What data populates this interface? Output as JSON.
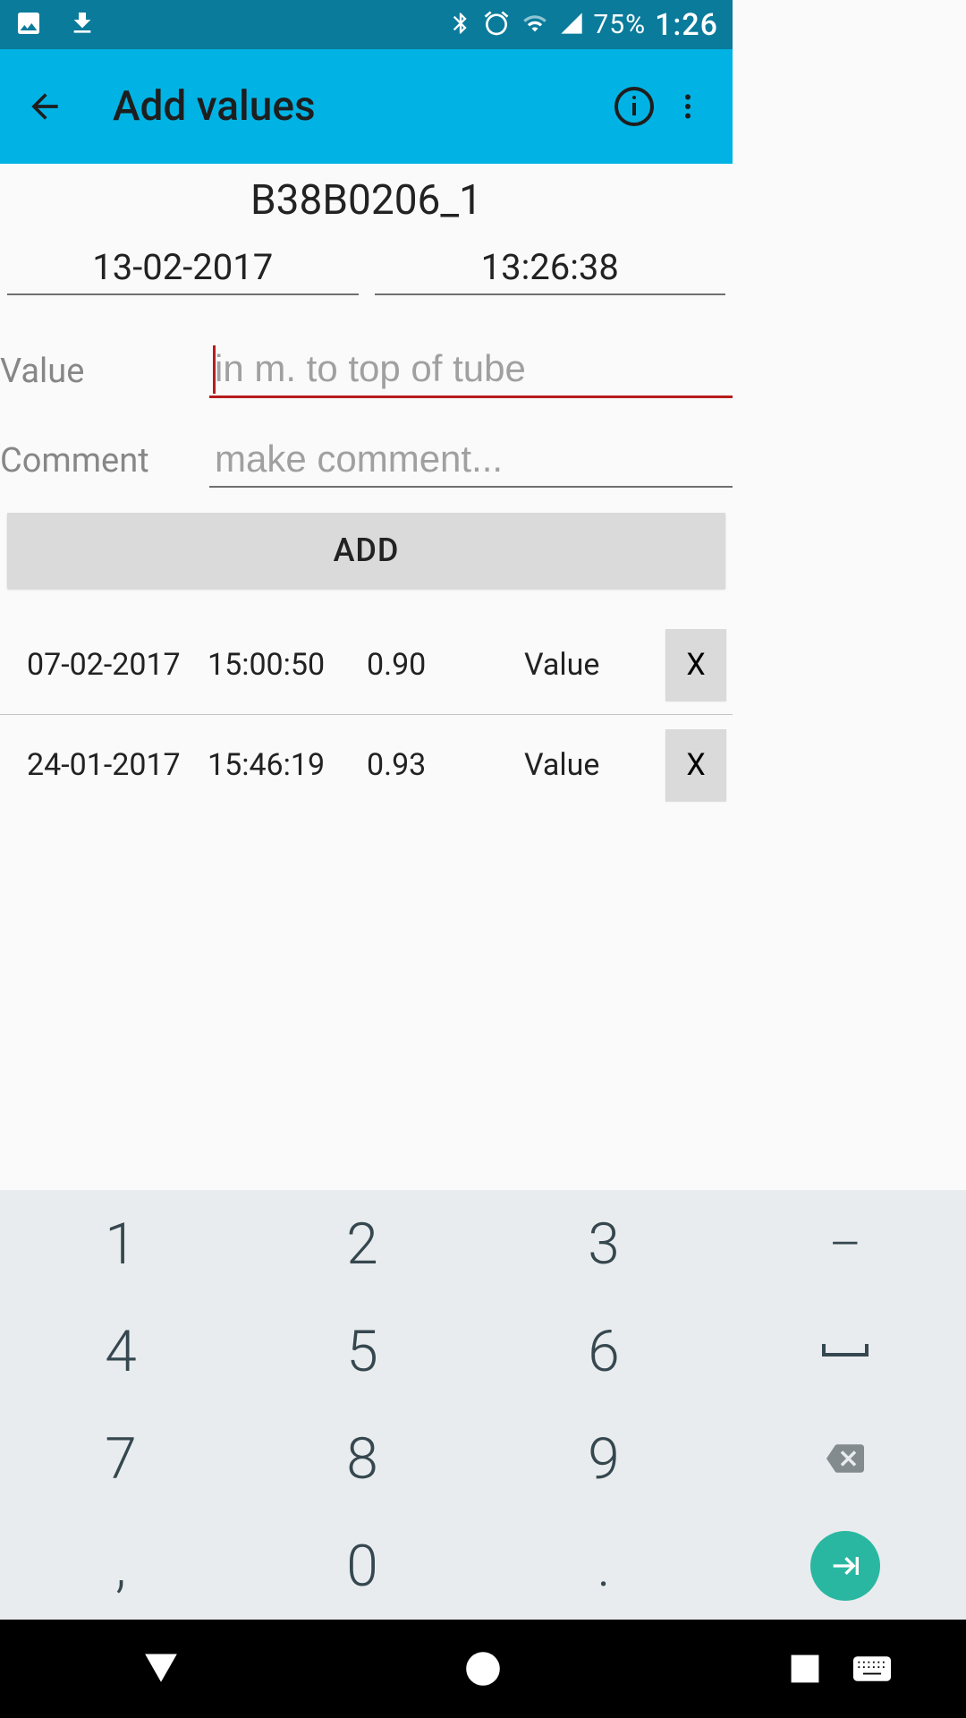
{
  "status": {
    "battery": "75%",
    "time": "1:26"
  },
  "appbar": {
    "title": "Add values"
  },
  "record_id": "B38B0206_1",
  "datetime": {
    "date": "13-02-2017",
    "time": "13:26:38"
  },
  "fields": {
    "value_label": "Value",
    "value_placeholder": "in m. to top of tube",
    "comment_label": "Comment",
    "comment_placeholder": "make comment..."
  },
  "add_button": "ADD",
  "history": [
    {
      "date": "07-02-2017",
      "time": "15:00:50",
      "value": "0.90",
      "label": "Value",
      "del": "X"
    },
    {
      "date": "24-01-2017",
      "time": "15:46:19",
      "value": "0.93",
      "label": "Value",
      "del": "X"
    }
  ],
  "keyboard": {
    "r1": [
      "1",
      "2",
      "3",
      "–"
    ],
    "r2": [
      "4",
      "5",
      "6",
      "⌴"
    ],
    "r3": [
      "7",
      "8",
      "9",
      ""
    ],
    "r4": [
      ",",
      "0",
      ".",
      ""
    ]
  }
}
